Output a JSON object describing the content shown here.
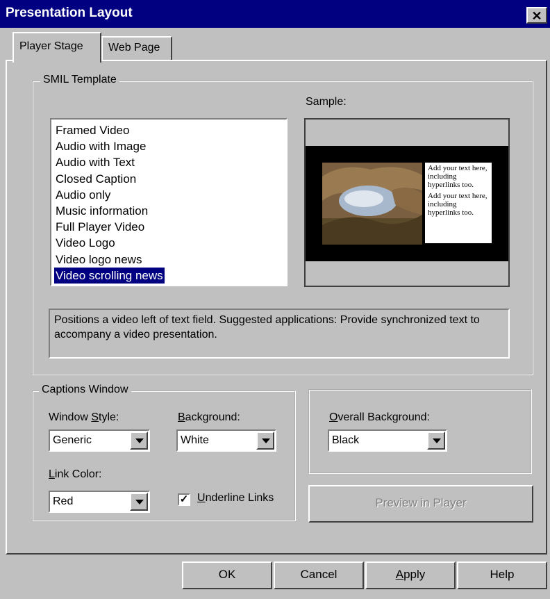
{
  "window": {
    "title": "Presentation Layout",
    "close_glyph": "✕"
  },
  "tabs": [
    {
      "label": "Player Stage",
      "active": true
    },
    {
      "label": "Web Page",
      "active": false
    }
  ],
  "smil": {
    "group_label": "SMIL Template",
    "sample_label": "Sample:",
    "templates": [
      "Framed Video",
      "Audio with Image",
      "Audio with Text",
      "Closed Caption",
      "Audio only",
      "Music information",
      "Full Player Video",
      "Video Logo",
      "Video logo news",
      "Video scrolling news"
    ],
    "selected_index": 9,
    "sample_text_1": "Add your text here, including hyperlinks too.",
    "sample_text_2": "Add your text here, including hyperlinks too.",
    "description": "Positions a video left of text field. Suggested applications: Provide synchronized text to accompany a video presentation."
  },
  "captions": {
    "group_label": "Captions Window",
    "window_style_label": "Window Style:",
    "window_style_value": "Generic",
    "background_label": "Background:",
    "background_value": "White",
    "link_color_label": "Link Color:",
    "link_color_value": "Red",
    "underline_links_label": "Underline Links",
    "underline_links_checked": true
  },
  "overall": {
    "label": "Overall Background:",
    "value": "Black"
  },
  "preview_button": "Preview in Player",
  "buttons": {
    "ok": "OK",
    "cancel": "Cancel",
    "apply": "Apply",
    "help": "Help"
  },
  "colors": {
    "titlebar": "#000080",
    "face": "#c0c0c0",
    "selection": "#000080"
  }
}
